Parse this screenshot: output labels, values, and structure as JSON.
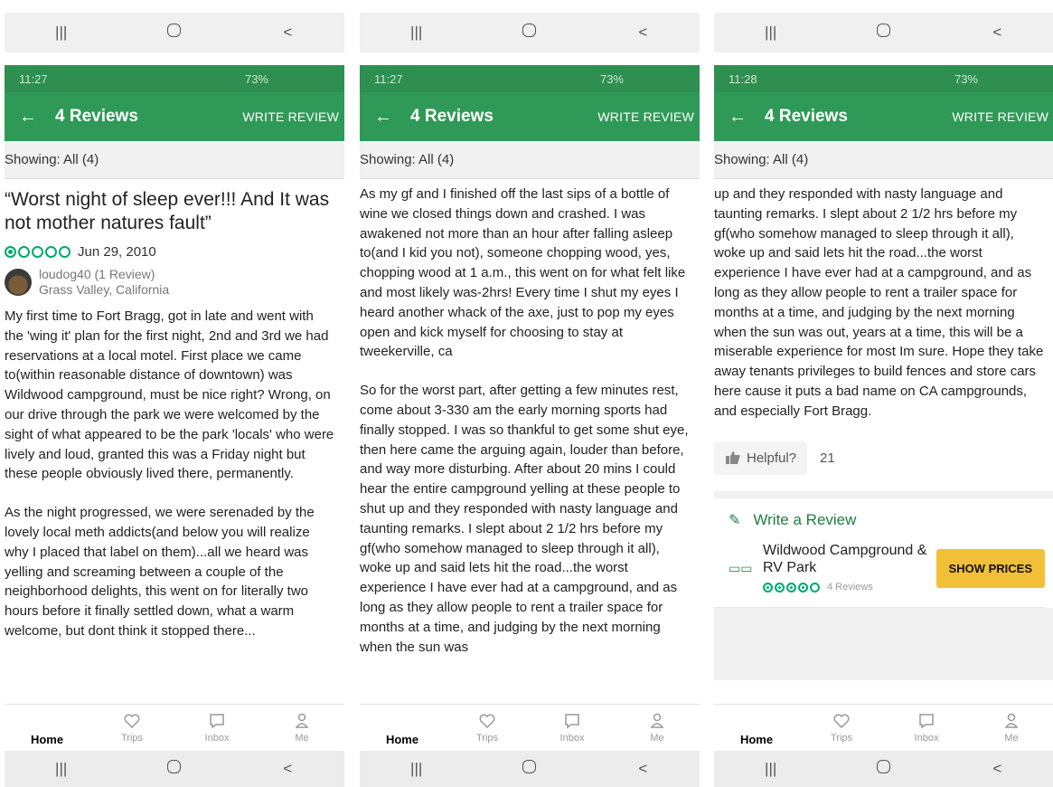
{
  "common": {
    "time1": "11:27",
    "time2": "11:27",
    "time3": "11:28",
    "status_right": "73%",
    "title": "4 Reviews",
    "back": "←",
    "write_review": "WRITE REVIEW",
    "showing": "Showing: All (4)",
    "nav_recents": "|||",
    "nav_back": "<",
    "tabs": [
      {
        "label": "Home",
        "icon": "compass-icon"
      },
      {
        "label": "Trips",
        "icon": "heart-icon"
      },
      {
        "label": "Inbox",
        "icon": "chat-icon"
      },
      {
        "label": "Me",
        "icon": "person-icon"
      }
    ]
  },
  "review": {
    "title": "“Worst night of sleep ever!!! And It was not mother natures fault”",
    "rating": 1,
    "date": "Jun 29, 2010",
    "author": "loudog40 (1 Review)",
    "location": "Grass Valley, California"
  },
  "screen1": {
    "p1": "My first time to Fort Bragg, got in late and went with the 'wing it' plan for the first night, 2nd and 3rd we had reservations at a local motel. First place we came to(within reasonable distance of downtown) was Wildwood campground, must be nice right? Wrong, on our drive through the park we were welcomed by the sight of what appeared to be the park 'locals' who were lively and loud, granted this was a Friday night but these people obviously lived there, permanently.",
    "p2": "As the night progressed, we were serenaded by the lovely local meth addicts(and below you will realize why I placed that label on them)...all we heard was yelling and screaming between a couple of the neighborhood delights, this went on for literally two hours before it finally settled down, what a warm welcome, but dont think it stopped there..."
  },
  "screen2": {
    "p1": "As my gf and I finished off the last sips of a bottle of wine we closed things down and crashed. I was awakened not more than an hour after falling asleep to(and I kid you not), someone chopping wood, yes, chopping wood at 1 a.m., this went on for what felt like and most likely was-2hrs! Every time I shut my eyes I heard another whack of the axe, just to pop my eyes open and kick myself for choosing to stay at tweekerville, ca",
    "p2": "So for the worst part, after getting a few minutes rest, come about 3-330 am the early morning sports had finally stopped. I was so thankful to get some shut eye, then here came the arguing again, louder than before, and way more disturbing. After about 20 mins I could hear the entire campground yelling at these people to shut up and they responded with nasty language and taunting remarks. I slept about 2 1/2 hrs before my gf(who somehow managed to sleep through it all), woke up and said lets hit the road...the worst experience I have ever had at a campground, and as long as they allow people to rent a trailer space for months at a time, and judging by the next morning when the sun was"
  },
  "screen3": {
    "p1": "up and they responded with nasty language and taunting remarks. I slept about 2 1/2 hrs before my gf(who somehow managed to sleep through it all), woke up and said lets hit the road...the worst experience I have ever had at a campground, and as long as they allow people to rent a trailer space for months at a time, and judging by the next morning when the sun was out, years at a time, this will be a miserable experience for most Im sure. Hope they take away tenants privileges to build fences and store cars here cause it puts a bad name on CA campgrounds, and especially Fort Bragg.",
    "helpful_label": "Helpful?",
    "helpful_count": "21",
    "write_a_review": "Write a Review",
    "business_name": "Wildwood Campground & RV Park",
    "business_rating": 4,
    "business_reviews": "4 Reviews",
    "show_prices": "SHOW PRICES"
  },
  "colors": {
    "status_green": "#2e8f51",
    "appbar_green": "#2f9a57",
    "bubble_green": "#00aa6c",
    "show_prices_yellow": "#f2c037"
  }
}
